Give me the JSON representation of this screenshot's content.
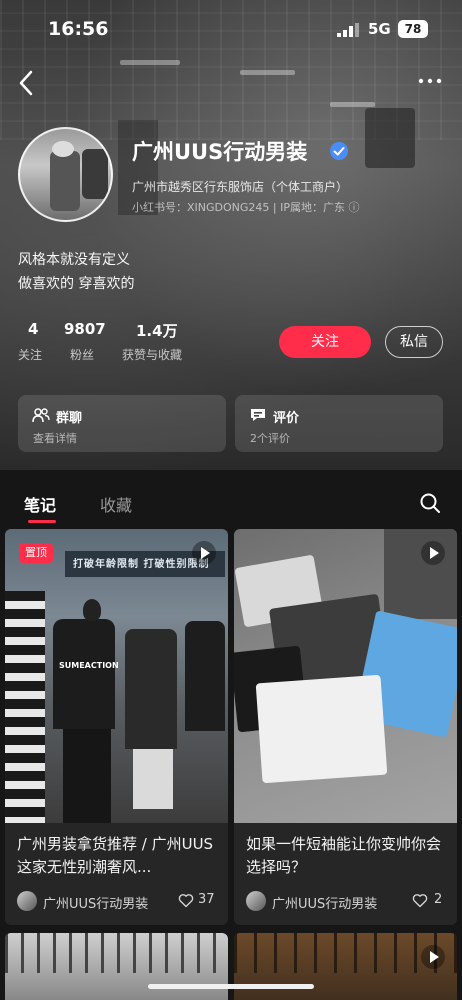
{
  "status": {
    "time": "16:56",
    "network": "5G",
    "battery": "78"
  },
  "profile": {
    "name": "广州UUS行动男装",
    "company": "广州市越秀区行东服饰店（个体工商户）",
    "id_line": "小红书号：XINGDONG245 | IP属地：广东 ⓘ",
    "bio_line1": "风格本就没有定义",
    "bio_line2": "做喜欢的 穿喜欢的"
  },
  "stats": [
    {
      "value": "4",
      "label": "关注"
    },
    {
      "value": "9807",
      "label": "粉丝"
    },
    {
      "value": "1.4万",
      "label": "获赞与收藏"
    }
  ],
  "actions": {
    "follow": "关注",
    "message": "私信"
  },
  "cards": [
    {
      "title": "群聊",
      "sub": "查看详情",
      "icon": "group-chat-icon"
    },
    {
      "title": "评价",
      "sub": "2个评价",
      "icon": "review-icon"
    }
  ],
  "tabs": {
    "active": "笔记",
    "inactive": "收藏"
  },
  "posts": [
    {
      "title": "广州男装拿货推荐 / 广州UUS 这家无性别潮奢风...",
      "author": "广州UUS行动男装",
      "likes": "37",
      "badge": "置顶",
      "banner": "打破年龄限制 打破性别限制"
    },
    {
      "title": "如果一件短袖能让你变帅你会选择吗？",
      "author": "广州UUS行动男装",
      "likes": "2"
    }
  ],
  "colors": {
    "accent": "#ff2c4a",
    "verified": "#4a8df8",
    "card_bg": "#262626"
  }
}
